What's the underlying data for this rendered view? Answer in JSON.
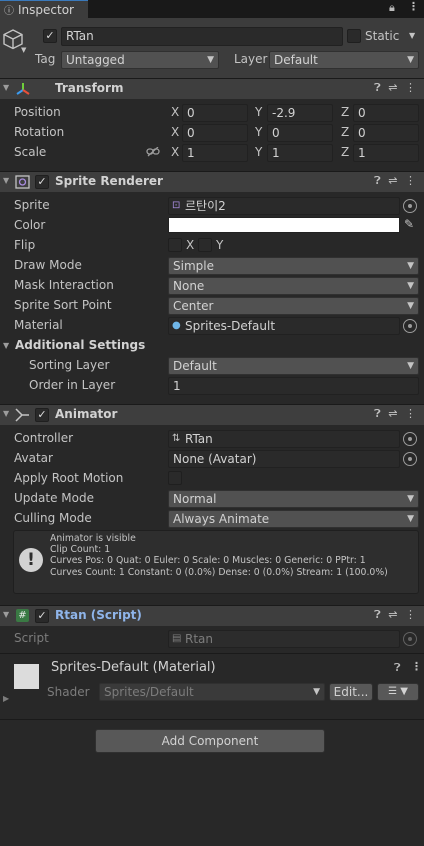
{
  "tab": {
    "title": "Inspector",
    "lock_icon": "lock-icon",
    "menu_icon": "kebab-menu-icon"
  },
  "object": {
    "name": "RTan",
    "static_label": "Static",
    "tag_label": "Tag",
    "tag_value": "Untagged",
    "layer_label": "Layer",
    "layer_value": "Default"
  },
  "transform": {
    "title": "Transform",
    "rows": [
      {
        "label": "Position",
        "x": "0",
        "y": "-2.9",
        "z": "0"
      },
      {
        "label": "Rotation",
        "x": "0",
        "y": "0",
        "z": "0"
      },
      {
        "label": "Scale",
        "x": "1",
        "y": "1",
        "z": "1"
      }
    ],
    "axis": {
      "x": "X",
      "y": "Y",
      "z": "Z"
    }
  },
  "sprite_renderer": {
    "title": "Sprite Renderer",
    "sprite_label": "Sprite",
    "sprite_value": "르탄이2",
    "color_label": "Color",
    "color_value": "#ffffff",
    "flip_label": "Flip",
    "flip_x": "X",
    "flip_y": "Y",
    "draw_mode_label": "Draw Mode",
    "draw_mode_value": "Simple",
    "mask_label": "Mask Interaction",
    "mask_value": "None",
    "sort_point_label": "Sprite Sort Point",
    "sort_point_value": "Center",
    "material_label": "Material",
    "material_value": "Sprites-Default",
    "additional_label": "Additional Settings",
    "sorting_layer_label": "Sorting Layer",
    "sorting_layer_value": "Default",
    "order_label": "Order in Layer",
    "order_value": "1"
  },
  "animator": {
    "title": "Animator",
    "controller_label": "Controller",
    "controller_value": "RTan",
    "avatar_label": "Avatar",
    "avatar_value": "None (Avatar)",
    "root_motion_label": "Apply Root Motion",
    "update_label": "Update Mode",
    "update_value": "Normal",
    "culling_label": "Culling Mode",
    "culling_value": "Always Animate",
    "info": [
      "Animator is visible",
      "Clip Count: 1",
      "Curves Pos: 0 Quat: 0 Euler: 0 Scale: 0 Muscles: 0 Generic: 0 PPtr: 1",
      "Curves Count: 1 Constant: 0 (0.0%) Dense: 0 (0.0%) Stream: 1 (100.0%)"
    ]
  },
  "script": {
    "title": "Rtan (Script)",
    "script_label": "Script",
    "script_value": "Rtan"
  },
  "material": {
    "title": "Sprites-Default (Material)",
    "shader_label": "Shader",
    "shader_value": "Sprites/Default",
    "edit_label": "Edit..."
  },
  "add_component_label": "Add Component",
  "colors": {
    "background": "#282828",
    "header": "#3e3e3e",
    "field": "#2a2a2a",
    "accent": "#3a79bb",
    "script_title": "#8fb5ea"
  }
}
